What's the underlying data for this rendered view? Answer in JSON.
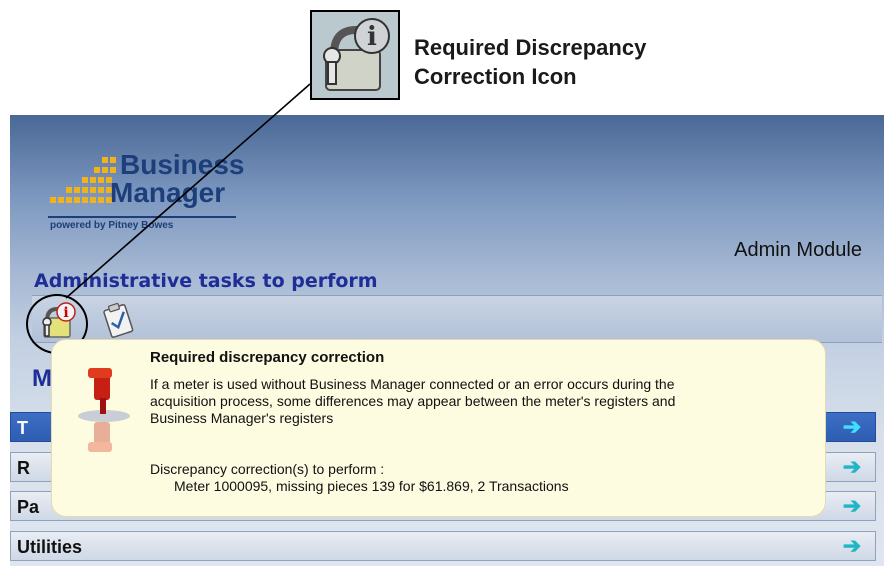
{
  "callout": {
    "title_line1": "Required Discrepancy",
    "title_line2": "Correction Icon",
    "icon": "lock-info-icon"
  },
  "app": {
    "logo": {
      "line1": "Business",
      "line2": "Manager",
      "powered": "powered by Pitney Bowes"
    },
    "module_title": "Admin Module",
    "admin_tasks_label": "Administrative tasks to perform",
    "toolbar_icons": [
      "lock-info-icon",
      "clipboard-check-icon"
    ],
    "partial_heading": "M",
    "menu": [
      {
        "label": "T",
        "active": true
      },
      {
        "label": "R",
        "active": false
      },
      {
        "label": "Pa",
        "active": false
      },
      {
        "label": "Utilities",
        "active": false
      }
    ],
    "arrow_glyph": "➔",
    "colors": {
      "header_blue": "#1e2e96",
      "arrow_cyan": "#21b6c4",
      "active_row": "#2e5db2",
      "tooltip_bg": "#fdfbe0"
    }
  },
  "tooltip": {
    "title": "Required discrepancy correction",
    "body_line1": "If a meter is used without Business Manager connected or an error occurs during the",
    "body_line2": "acquisition process, some differences may appear between the meter's registers and",
    "body_line3": "Business Manager's registers",
    "subhead": "Discrepancy correction(s) to perform :",
    "detail": "Meter 1000095, missing pieces 139 for $61.869, 2 Transactions"
  }
}
